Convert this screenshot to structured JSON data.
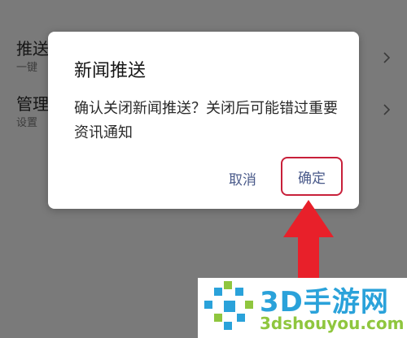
{
  "settings": {
    "rows": [
      {
        "title": "推送",
        "subtitle": "一键"
      },
      {
        "title": "管理",
        "subtitle": "设置"
      }
    ]
  },
  "dialog": {
    "title": "新闻推送",
    "message": "确认关闭新闻推送？关闭后可能错过重要资讯通知",
    "cancel_label": "取消",
    "confirm_label": "确定"
  },
  "annotation": {
    "highlight_color": "#c8203a",
    "arrow_color": "#e8202a",
    "arrow_icon": "arrow-up-icon"
  },
  "watermark": {
    "brand": "3D手游网",
    "url": "3dshouyou.com"
  },
  "colors": {
    "scrim": "#7a7a7a",
    "dialog_bg": "#ffffff",
    "button_text": "#4a5a8a"
  }
}
